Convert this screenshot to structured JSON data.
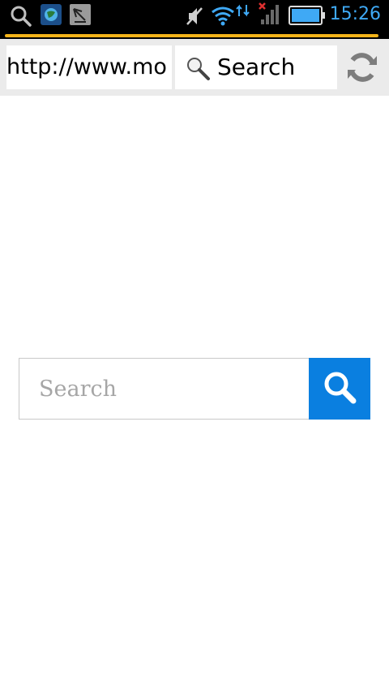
{
  "status_bar": {
    "time": "15:26",
    "icons": [
      "search-icon",
      "globe-app-icon",
      "satellite-app-icon",
      "mute-icon",
      "wifi-icon",
      "data-arrows-icon",
      "signal-no-service-icon",
      "battery-icon"
    ]
  },
  "loading": {
    "progress": 0.985,
    "color": "#f4b41a"
  },
  "toolbar": {
    "url": "http://www.mo",
    "search_label": "Search"
  },
  "main": {
    "search_placeholder": "Search",
    "accent": "#0a7fe0"
  }
}
